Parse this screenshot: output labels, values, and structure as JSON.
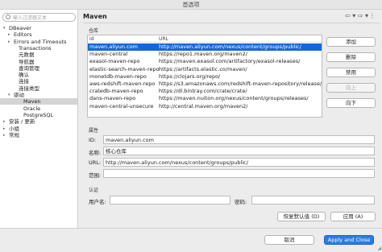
{
  "window": {
    "title": "首选项"
  },
  "filter": {
    "placeholder": "输入过滤器文本"
  },
  "tree": [
    {
      "label": "DBeaver",
      "expander": "▾"
    },
    {
      "label": "Editors",
      "expander": "▸"
    },
    {
      "label": "Errors and Timeouts",
      "expander": "▸"
    },
    {
      "label": "Transactions",
      "expander": ""
    },
    {
      "label": "元数据",
      "expander": ""
    },
    {
      "label": "导航器",
      "expander": ""
    },
    {
      "label": "查询管理",
      "expander": ""
    },
    {
      "label": "确认",
      "expander": ""
    },
    {
      "label": "连接",
      "expander": ""
    },
    {
      "label": "连接类型",
      "expander": ""
    },
    {
      "label": "驱动",
      "expander": "▾"
    },
    {
      "label": "Maven",
      "expander": ""
    },
    {
      "label": "Oracle",
      "expander": ""
    },
    {
      "label": "PostgreSQL",
      "expander": ""
    },
    {
      "label": "安装 / 更新",
      "expander": "▸"
    },
    {
      "label": "小组",
      "expander": "▸"
    },
    {
      "label": "常规",
      "expander": "▸"
    }
  ],
  "page": {
    "title": "Maven",
    "nav_arrows": "⇦ ▾ ⇨ ▾",
    "nav_menu": "⋮",
    "repo_section": "仓库",
    "columns": [
      "Id",
      "URL"
    ],
    "repos": [
      {
        "id": "maven.aliyun.com",
        "url": "http://maven.aliyun.com/nexus/content/groups/public/"
      },
      {
        "id": "maven-central",
        "url": "https://repo1.maven.org/maven2/"
      },
      {
        "id": "exasol-maven-repo",
        "url": "https://maven.exasol.com/artifactory/exasol-releases/"
      },
      {
        "id": "elastic-search-maven-repo",
        "url": "https://artifacts.elastic.co/maven/"
      },
      {
        "id": "monetdb-maven-repo",
        "url": "https://clojars.org/repo/"
      },
      {
        "id": "aws-redshift-maven-repo",
        "url": "https://s3.amazonaws.com/redshift-maven-repository/release/"
      },
      {
        "id": "cratedb-maven-repo",
        "url": "https://dl.bintray.com/crate/crate/"
      },
      {
        "id": "dans-maven-repo",
        "url": "https://maven.nuiton.org/nexus/content/groups/releases/"
      },
      {
        "id": "maven-central-unsecure",
        "url": "http://central.maven.org/maven2/"
      }
    ],
    "buttons": {
      "add": "添加",
      "remove": "删除",
      "disable": "禁用",
      "up": "向上",
      "down": "向下"
    },
    "props_section": "属性",
    "props": {
      "id_label": "ID:",
      "id_value": "maven.aliyun.com",
      "name_label": "名称:",
      "name_value": "核心仓库",
      "url_label": "URL:",
      "url_value": "http://maven.aliyun.com/nexus/content/groups/public/",
      "scope_label": "范围:",
      "scope_value": ""
    },
    "auth_section": "认证",
    "auth": {
      "user_label": "用户名:",
      "user_value": "",
      "password_label": "密码:",
      "password_value": ""
    },
    "restore_defaults": "恢复默认值 (D)",
    "apply": "应用 (A)"
  },
  "footer": {
    "cancel": "取消",
    "apply_close": "Apply and Close"
  }
}
